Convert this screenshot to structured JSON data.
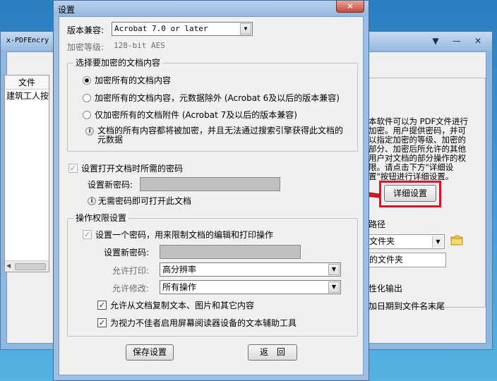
{
  "background_window": {
    "title": "x-PDFEncry",
    "controls": [
      "▼",
      "—",
      "✕"
    ],
    "table_header": "文件",
    "table_row": "建筑工人按",
    "description": "本软件可以为 PDF文件进行加密。用户提供密码，并可以指定加密的等级、加密的部分、加密后所允许的其他用户对文档的部分操作的权限。请点击下方\"详细设置\"按钮进行详细设置。",
    "detail_button": "详细设置",
    "path_label": "路径",
    "folder_select": "文件夹",
    "folder_input": "的文件夹",
    "option_1": "性化输出",
    "option_2": "加日期到文件名末尾"
  },
  "dialog": {
    "title": "设置",
    "close": "✕",
    "compat_label": "版本兼容:",
    "compat_value": "Acrobat 7.0 or later",
    "level_label": "加密等级:",
    "level_value": "128-bit AES",
    "content_group": {
      "legend": "选择要加密的文档内容",
      "option_all": "加密所有的文档内容",
      "option_except_meta": "加密所有的文档内容，元数据除外 (Acrobat 6及以后的版本兼容)",
      "option_attachments": "仅加密所有的文档附件 (Acrobat 7及以后的版本兼容)",
      "selected": "option_all",
      "note": "文档的所有内容都将被加密，并且无法通过搜索引擎获得此文档的元数据"
    },
    "open_password": {
      "checkbox_label": "设置打开文档时所需的密码",
      "checked": true,
      "new_password_label": "设置新密码:",
      "note": "无需密码即可打开此文档"
    },
    "permissions_group": {
      "legend": "操作权限设置",
      "checkbox_label": "设置一个密码，用来限制文档的编辑和打印操作",
      "new_password_label": "设置新密码:",
      "print_label": "允许打印:",
      "print_value": "高分辨率",
      "modify_label": "允许修改:",
      "modify_value": "所有操作",
      "copy_label": "允许从文档复制文本、图片和其它内容",
      "accessibility_label": "为视力不佳者启用屏幕阅读器设备的文本辅助工具"
    },
    "save_button": "保存设置",
    "back_button": "返　回"
  },
  "colors": {
    "annotation_red": "#d9142b",
    "close_button": "#c8493a",
    "window_frame": "#9dbfe2"
  }
}
